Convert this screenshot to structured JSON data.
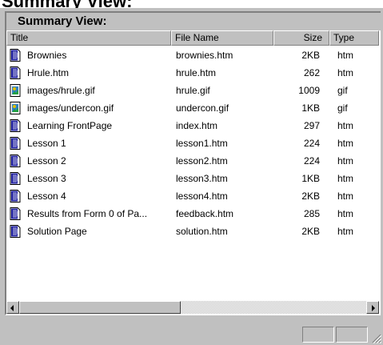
{
  "panel": {
    "title": "Summary View:"
  },
  "columns": [
    {
      "label": "Title"
    },
    {
      "label": "File Name"
    },
    {
      "label": "Size"
    },
    {
      "label": "Type"
    }
  ],
  "rows": [
    {
      "icon": "html-page-icon",
      "title": "Brownies",
      "file": "brownies.htm",
      "size": "2KB",
      "type": "htm"
    },
    {
      "icon": "html-page-icon",
      "title": "Hrule.htm",
      "file": "hrule.htm",
      "size": "262",
      "type": "htm"
    },
    {
      "icon": "image-file-icon",
      "title": "images/hrule.gif",
      "file": "hrule.gif",
      "size": "1009",
      "type": "gif"
    },
    {
      "icon": "image-file-icon",
      "title": "images/undercon.gif",
      "file": "undercon.gif",
      "size": "1KB",
      "type": "gif"
    },
    {
      "icon": "html-page-icon",
      "title": "Learning FrontPage",
      "file": "index.htm",
      "size": "297",
      "type": "htm"
    },
    {
      "icon": "html-page-icon",
      "title": "Lesson 1",
      "file": "lesson1.htm",
      "size": "224",
      "type": "htm"
    },
    {
      "icon": "html-page-icon",
      "title": "Lesson 2",
      "file": "lesson2.htm",
      "size": "224",
      "type": "htm"
    },
    {
      "icon": "html-page-icon",
      "title": "Lesson 3",
      "file": "lesson3.htm",
      "size": "1KB",
      "type": "htm"
    },
    {
      "icon": "html-page-icon",
      "title": "Lesson 4",
      "file": "lesson4.htm",
      "size": "2KB",
      "type": "htm"
    },
    {
      "icon": "html-page-icon",
      "title": "Results from Form 0 of Pa...",
      "file": "feedback.htm",
      "size": "285",
      "type": "htm"
    },
    {
      "icon": "html-page-icon",
      "title": "Solution Page",
      "file": "solution.htm",
      "size": "2KB",
      "type": "htm"
    }
  ],
  "scrollbar": {
    "left_icon": "scroll-left-arrow-icon",
    "right_icon": "scroll-right-arrow-icon"
  },
  "colors": {
    "face": "#c0c0c0",
    "shadow": "#808080",
    "highlight": "#ffffff",
    "page_icon": "#2020a0",
    "image_icon_accent": "#e0c000"
  }
}
